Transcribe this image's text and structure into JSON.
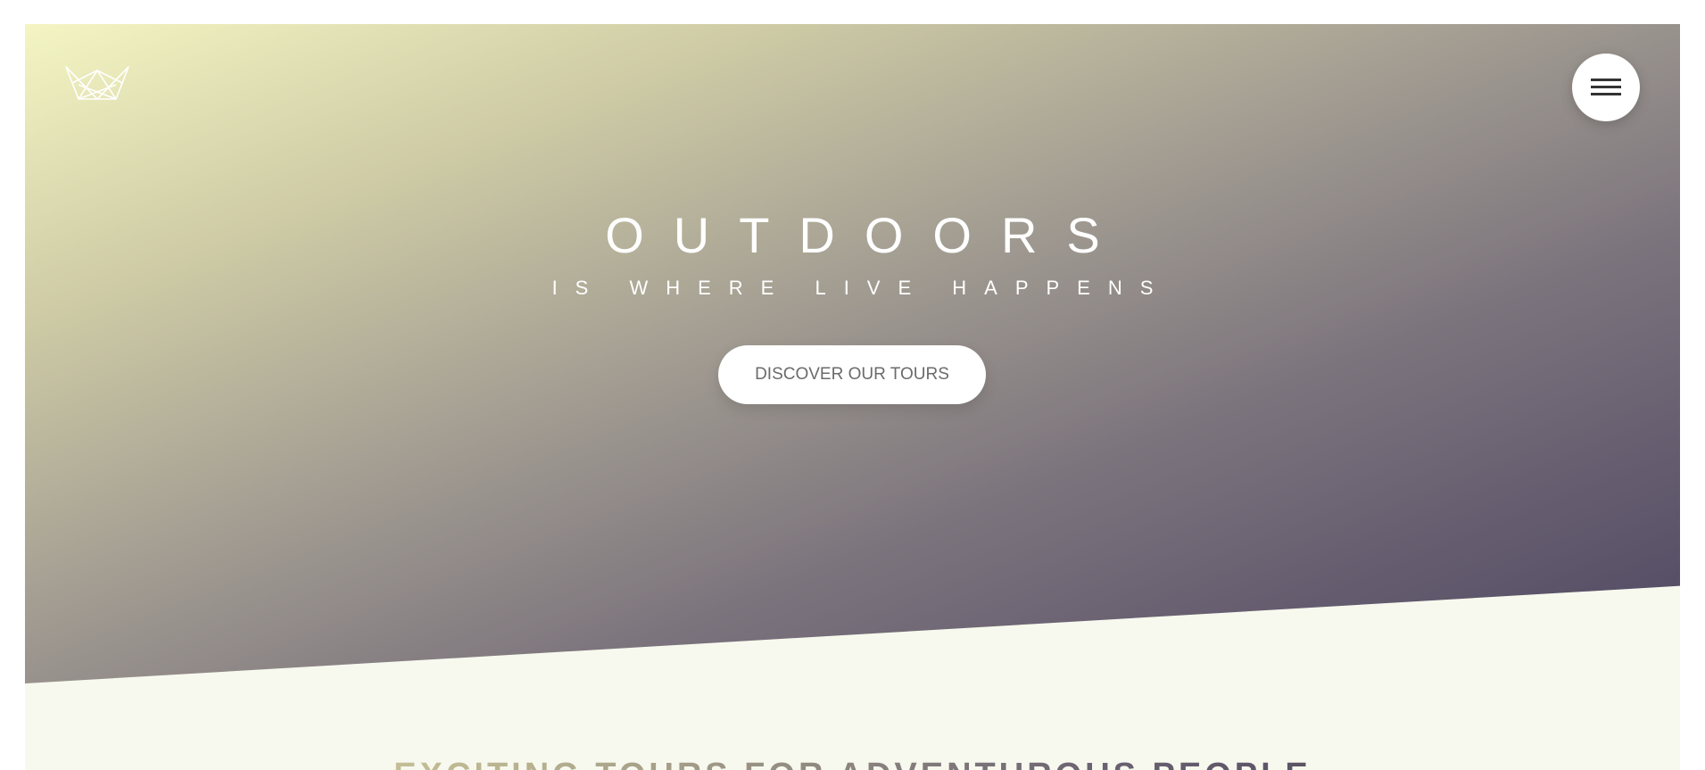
{
  "header": {
    "logo_icon": "crown-outline-icon",
    "menu_icon": "hamburger-menu-icon"
  },
  "hero": {
    "title_main": "OUTDOORS",
    "title_sub": "IS WHERE LIVE HAPPENS",
    "cta_label": "DISCOVER OUR TOURS"
  },
  "section": {
    "title": "EXCITING TOURS FOR ADVENTUROUS PEOPLE"
  },
  "colors": {
    "hero_gradient_start": "#f4f5c3",
    "hero_gradient_end": "#4d4560",
    "section_background": "#f7f9ee",
    "button_background": "#ffffff",
    "button_text": "#6b6b6b"
  }
}
